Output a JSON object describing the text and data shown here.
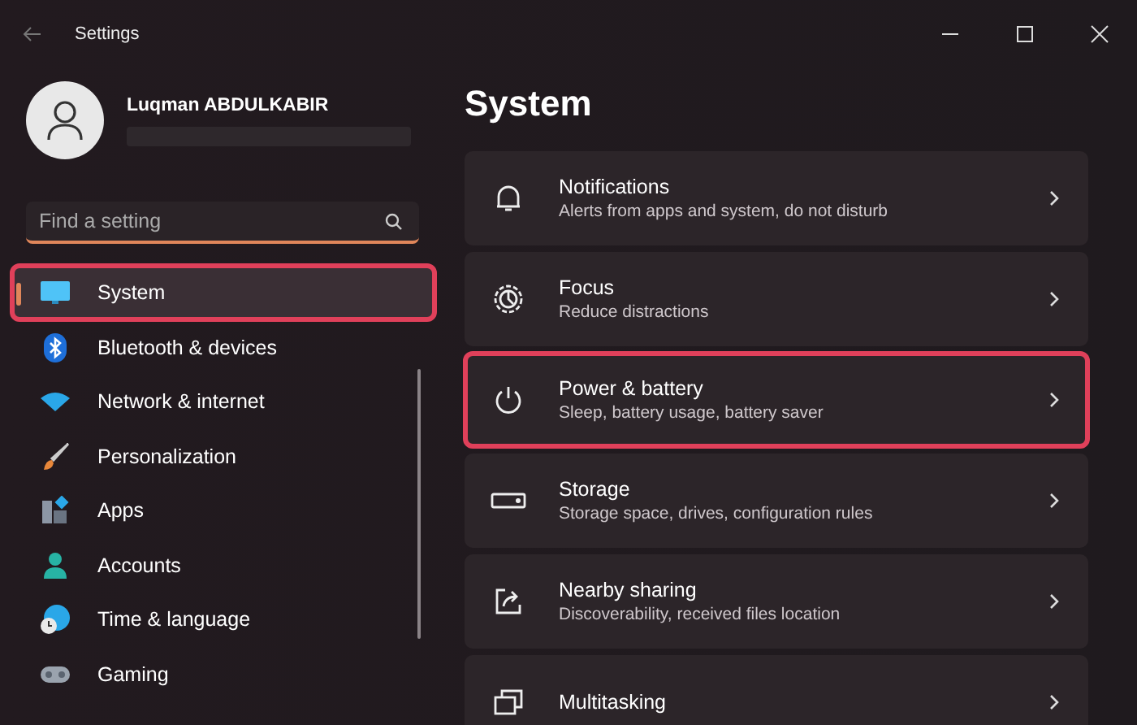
{
  "window": {
    "title": "Settings"
  },
  "profile": {
    "name": "Luqman ABDULKABIR"
  },
  "search": {
    "placeholder": "Find a setting"
  },
  "sidebar": {
    "items": [
      {
        "label": "System",
        "selected": true,
        "highlighted": true
      },
      {
        "label": "Bluetooth & devices",
        "selected": false,
        "highlighted": false
      },
      {
        "label": "Network & internet",
        "selected": false,
        "highlighted": false
      },
      {
        "label": "Personalization",
        "selected": false,
        "highlighted": false
      },
      {
        "label": "Apps",
        "selected": false,
        "highlighted": false
      },
      {
        "label": "Accounts",
        "selected": false,
        "highlighted": false
      },
      {
        "label": "Time & language",
        "selected": false,
        "highlighted": false
      },
      {
        "label": "Gaming",
        "selected": false,
        "highlighted": false
      }
    ]
  },
  "page": {
    "title": "System",
    "cards": [
      {
        "title": "Notifications",
        "subtitle": "Alerts from apps and system, do not disturb",
        "highlighted": false
      },
      {
        "title": "Focus",
        "subtitle": "Reduce distractions",
        "highlighted": false
      },
      {
        "title": "Power & battery",
        "subtitle": "Sleep, battery usage, battery saver",
        "highlighted": true
      },
      {
        "title": "Storage",
        "subtitle": "Storage space, drives, configuration rules",
        "highlighted": false
      },
      {
        "title": "Nearby sharing",
        "subtitle": "Discoverability, received files location",
        "highlighted": false
      },
      {
        "title": "Multitasking",
        "highlighted": false
      }
    ]
  }
}
